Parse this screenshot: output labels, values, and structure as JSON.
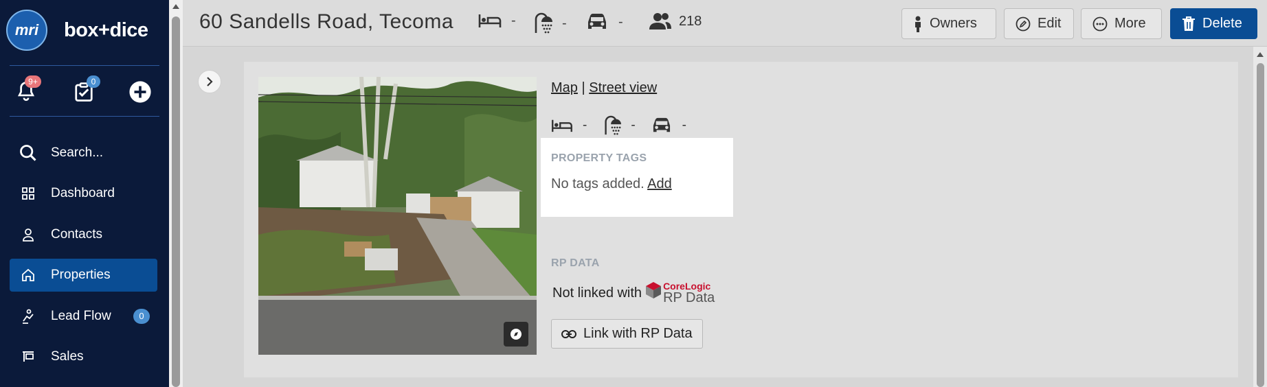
{
  "brand": {
    "logo_text": "mri",
    "name": "box+dice"
  },
  "quick": {
    "notifications_badge": "9+",
    "tasks_badge": "0"
  },
  "sidebar": {
    "items": [
      {
        "label": "Search..."
      },
      {
        "label": "Dashboard"
      },
      {
        "label": "Contacts"
      },
      {
        "label": "Properties"
      },
      {
        "label": "Lead Flow",
        "count": "0"
      },
      {
        "label": "Sales"
      }
    ]
  },
  "header": {
    "title": "60 Sandells Road, Tecoma",
    "beds": "-",
    "baths": "-",
    "cars": "-",
    "contacts_count": "218",
    "buttons": {
      "owners": "Owners",
      "edit": "Edit",
      "more": "More",
      "delete": "Delete"
    }
  },
  "property": {
    "map_link": "Map",
    "separator": "|",
    "street_view_link": "Street view",
    "beds": "-",
    "baths": "-",
    "cars": "-",
    "tags": {
      "title": "PROPERTY TAGS",
      "empty_text": "No tags added.",
      "add_link": "Add"
    },
    "rp_data": {
      "title": "RP DATA",
      "status_text": "Not linked with",
      "logo_top": "CoreLogic",
      "logo_bottom": "RP Data",
      "link_button": "Link with RP Data"
    }
  },
  "colors": {
    "sidebar_bg": "#0b1a3a",
    "primary": "#0a4d94",
    "badge_red": "#e8767a",
    "badge_blue": "#4a8fd0"
  }
}
